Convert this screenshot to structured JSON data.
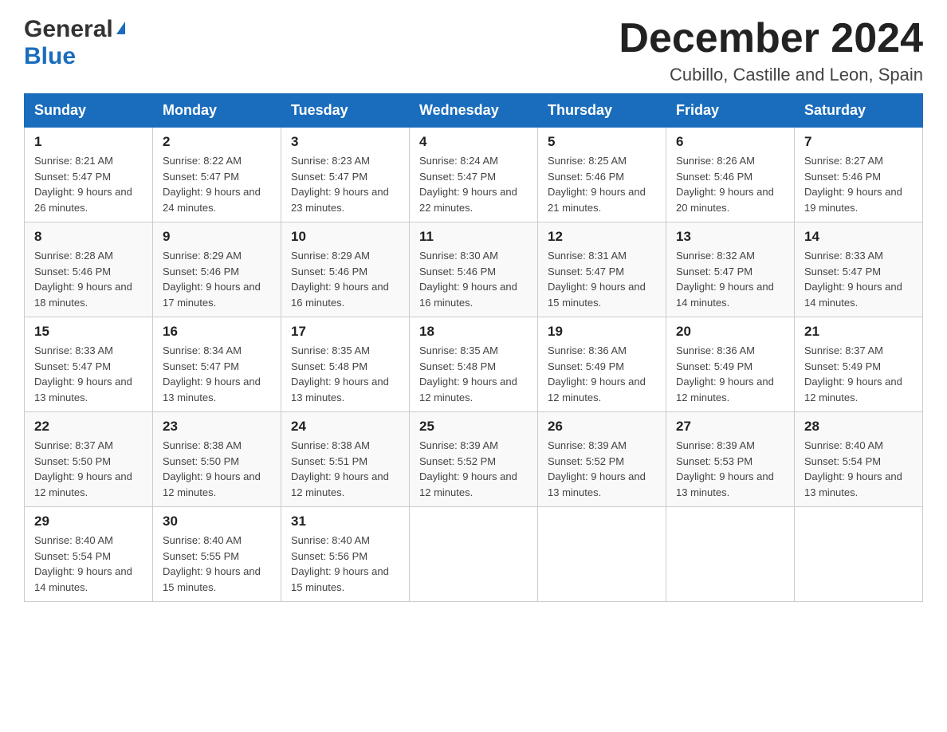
{
  "header": {
    "logo": {
      "general": "General",
      "blue": "Blue"
    },
    "title": "December 2024",
    "location": "Cubillo, Castille and Leon, Spain"
  },
  "calendar": {
    "headers": [
      "Sunday",
      "Monday",
      "Tuesday",
      "Wednesday",
      "Thursday",
      "Friday",
      "Saturday"
    ],
    "weeks": [
      [
        {
          "day": "1",
          "sunrise": "Sunrise: 8:21 AM",
          "sunset": "Sunset: 5:47 PM",
          "daylight": "Daylight: 9 hours and 26 minutes."
        },
        {
          "day": "2",
          "sunrise": "Sunrise: 8:22 AM",
          "sunset": "Sunset: 5:47 PM",
          "daylight": "Daylight: 9 hours and 24 minutes."
        },
        {
          "day": "3",
          "sunrise": "Sunrise: 8:23 AM",
          "sunset": "Sunset: 5:47 PM",
          "daylight": "Daylight: 9 hours and 23 minutes."
        },
        {
          "day": "4",
          "sunrise": "Sunrise: 8:24 AM",
          "sunset": "Sunset: 5:47 PM",
          "daylight": "Daylight: 9 hours and 22 minutes."
        },
        {
          "day": "5",
          "sunrise": "Sunrise: 8:25 AM",
          "sunset": "Sunset: 5:46 PM",
          "daylight": "Daylight: 9 hours and 21 minutes."
        },
        {
          "day": "6",
          "sunrise": "Sunrise: 8:26 AM",
          "sunset": "Sunset: 5:46 PM",
          "daylight": "Daylight: 9 hours and 20 minutes."
        },
        {
          "day": "7",
          "sunrise": "Sunrise: 8:27 AM",
          "sunset": "Sunset: 5:46 PM",
          "daylight": "Daylight: 9 hours and 19 minutes."
        }
      ],
      [
        {
          "day": "8",
          "sunrise": "Sunrise: 8:28 AM",
          "sunset": "Sunset: 5:46 PM",
          "daylight": "Daylight: 9 hours and 18 minutes."
        },
        {
          "day": "9",
          "sunrise": "Sunrise: 8:29 AM",
          "sunset": "Sunset: 5:46 PM",
          "daylight": "Daylight: 9 hours and 17 minutes."
        },
        {
          "day": "10",
          "sunrise": "Sunrise: 8:29 AM",
          "sunset": "Sunset: 5:46 PM",
          "daylight": "Daylight: 9 hours and 16 minutes."
        },
        {
          "day": "11",
          "sunrise": "Sunrise: 8:30 AM",
          "sunset": "Sunset: 5:46 PM",
          "daylight": "Daylight: 9 hours and 16 minutes."
        },
        {
          "day": "12",
          "sunrise": "Sunrise: 8:31 AM",
          "sunset": "Sunset: 5:47 PM",
          "daylight": "Daylight: 9 hours and 15 minutes."
        },
        {
          "day": "13",
          "sunrise": "Sunrise: 8:32 AM",
          "sunset": "Sunset: 5:47 PM",
          "daylight": "Daylight: 9 hours and 14 minutes."
        },
        {
          "day": "14",
          "sunrise": "Sunrise: 8:33 AM",
          "sunset": "Sunset: 5:47 PM",
          "daylight": "Daylight: 9 hours and 14 minutes."
        }
      ],
      [
        {
          "day": "15",
          "sunrise": "Sunrise: 8:33 AM",
          "sunset": "Sunset: 5:47 PM",
          "daylight": "Daylight: 9 hours and 13 minutes."
        },
        {
          "day": "16",
          "sunrise": "Sunrise: 8:34 AM",
          "sunset": "Sunset: 5:47 PM",
          "daylight": "Daylight: 9 hours and 13 minutes."
        },
        {
          "day": "17",
          "sunrise": "Sunrise: 8:35 AM",
          "sunset": "Sunset: 5:48 PM",
          "daylight": "Daylight: 9 hours and 13 minutes."
        },
        {
          "day": "18",
          "sunrise": "Sunrise: 8:35 AM",
          "sunset": "Sunset: 5:48 PM",
          "daylight": "Daylight: 9 hours and 12 minutes."
        },
        {
          "day": "19",
          "sunrise": "Sunrise: 8:36 AM",
          "sunset": "Sunset: 5:49 PM",
          "daylight": "Daylight: 9 hours and 12 minutes."
        },
        {
          "day": "20",
          "sunrise": "Sunrise: 8:36 AM",
          "sunset": "Sunset: 5:49 PM",
          "daylight": "Daylight: 9 hours and 12 minutes."
        },
        {
          "day": "21",
          "sunrise": "Sunrise: 8:37 AM",
          "sunset": "Sunset: 5:49 PM",
          "daylight": "Daylight: 9 hours and 12 minutes."
        }
      ],
      [
        {
          "day": "22",
          "sunrise": "Sunrise: 8:37 AM",
          "sunset": "Sunset: 5:50 PM",
          "daylight": "Daylight: 9 hours and 12 minutes."
        },
        {
          "day": "23",
          "sunrise": "Sunrise: 8:38 AM",
          "sunset": "Sunset: 5:50 PM",
          "daylight": "Daylight: 9 hours and 12 minutes."
        },
        {
          "day": "24",
          "sunrise": "Sunrise: 8:38 AM",
          "sunset": "Sunset: 5:51 PM",
          "daylight": "Daylight: 9 hours and 12 minutes."
        },
        {
          "day": "25",
          "sunrise": "Sunrise: 8:39 AM",
          "sunset": "Sunset: 5:52 PM",
          "daylight": "Daylight: 9 hours and 12 minutes."
        },
        {
          "day": "26",
          "sunrise": "Sunrise: 8:39 AM",
          "sunset": "Sunset: 5:52 PM",
          "daylight": "Daylight: 9 hours and 13 minutes."
        },
        {
          "day": "27",
          "sunrise": "Sunrise: 8:39 AM",
          "sunset": "Sunset: 5:53 PM",
          "daylight": "Daylight: 9 hours and 13 minutes."
        },
        {
          "day": "28",
          "sunrise": "Sunrise: 8:40 AM",
          "sunset": "Sunset: 5:54 PM",
          "daylight": "Daylight: 9 hours and 13 minutes."
        }
      ],
      [
        {
          "day": "29",
          "sunrise": "Sunrise: 8:40 AM",
          "sunset": "Sunset: 5:54 PM",
          "daylight": "Daylight: 9 hours and 14 minutes."
        },
        {
          "day": "30",
          "sunrise": "Sunrise: 8:40 AM",
          "sunset": "Sunset: 5:55 PM",
          "daylight": "Daylight: 9 hours and 15 minutes."
        },
        {
          "day": "31",
          "sunrise": "Sunrise: 8:40 AM",
          "sunset": "Sunset: 5:56 PM",
          "daylight": "Daylight: 9 hours and 15 minutes."
        },
        null,
        null,
        null,
        null
      ]
    ]
  }
}
